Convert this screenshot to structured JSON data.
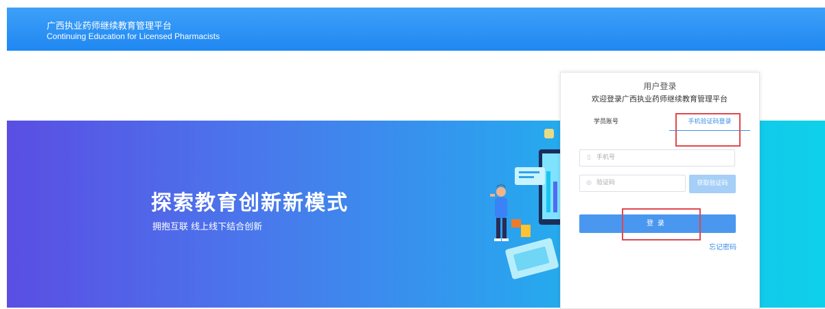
{
  "header": {
    "title_cn": "广西执业药师继续教育管理平台",
    "title_en": "Continuing Education for Licensed Pharmacists",
    "background_color": "#2a8ff5"
  },
  "banner": {
    "headline": "探索教育创新新模式",
    "subline": "拥抱互联  线上线下结合创新",
    "gradient_start": "#5a4ee3",
    "gradient_end": "#0fd0ea"
  },
  "login": {
    "title": "用户登录",
    "welcome": "欢迎登录广西执业药师继续教育管理平台",
    "tabs": [
      {
        "label": "学员账号",
        "active": false
      },
      {
        "label": "手机验证码登录",
        "active": true
      }
    ],
    "phone_input": {
      "placeholder": "手机号",
      "value": "",
      "icon": "phone-icon"
    },
    "code_input": {
      "placeholder": "验证码",
      "value": "",
      "icon": "shield-icon"
    },
    "get_code_label": "获取验证码",
    "submit_label": "登录",
    "forgot_label": "忘记密码",
    "accent_color": "#4a97f0",
    "highlight_color": "#e0474c"
  }
}
